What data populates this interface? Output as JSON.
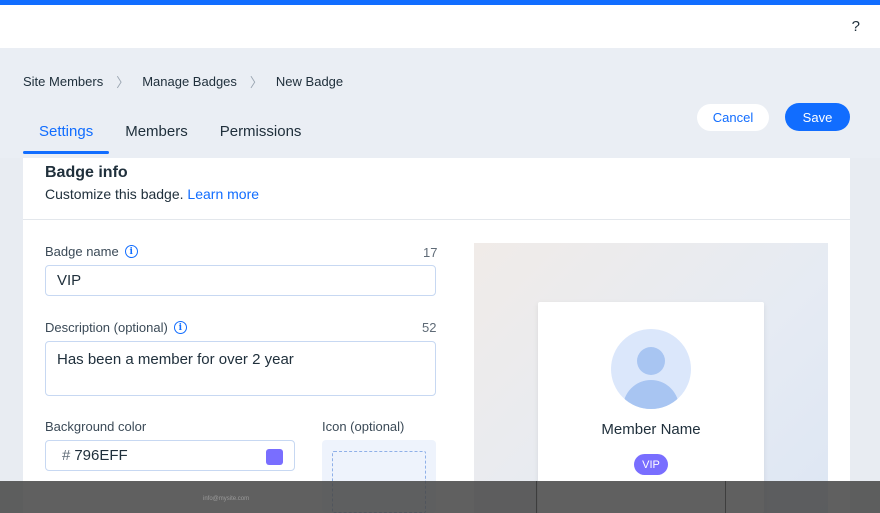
{
  "topbar": {
    "help_label": "?"
  },
  "breadcrumb": {
    "items": [
      "Site Members",
      "Manage Badges",
      "New Badge"
    ],
    "separator": "〉"
  },
  "tabs": [
    {
      "label": "Settings",
      "active": true
    },
    {
      "label": "Members",
      "active": false
    },
    {
      "label": "Permissions",
      "active": false
    }
  ],
  "actions": {
    "cancel_label": "Cancel",
    "save_label": "Save"
  },
  "badge_info": {
    "title": "Badge info",
    "subtitle": "Customize this badge.",
    "learn_more": "Learn more"
  },
  "form": {
    "name_label": "Badge name",
    "name_value": "VIP",
    "name_counter": "17",
    "description_label": "Description (optional)",
    "description_value": "Has been a member for over 2 year",
    "description_counter": "52",
    "bg_color_label": "Background color",
    "bg_color_hash": "#",
    "bg_color_value": "796EFF",
    "icon_label": "Icon (optional)"
  },
  "preview": {
    "member_name": "Member Name",
    "badge_text": "VIP"
  },
  "overlay": {
    "text": "info@mysite.com"
  },
  "colors": {
    "accent": "#116dff",
    "badge_color": "#796eff"
  }
}
